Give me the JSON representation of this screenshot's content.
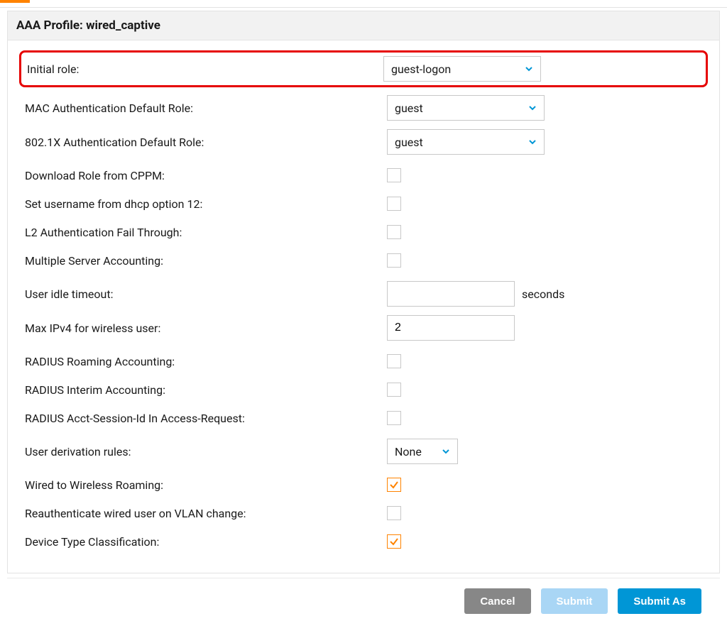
{
  "header": {
    "title": "AAA Profile: wired_captive"
  },
  "colors": {
    "accent_orange": "#ff8300",
    "accent_blue": "#0096d6",
    "highlight_red": "#e60000"
  },
  "fields": {
    "initial_role": {
      "label": "Initial role:",
      "value": "guest-logon"
    },
    "mac_auth_default_role": {
      "label": "MAC Authentication Default Role:",
      "value": "guest"
    },
    "dot1x_auth_default_role": {
      "label": "802.1X Authentication Default Role:",
      "value": "guest"
    },
    "download_role_cppm": {
      "label": "Download Role from CPPM:",
      "checked": false
    },
    "set_username_dhcp12": {
      "label": "Set username from dhcp option 12:",
      "checked": false
    },
    "l2_auth_fail_through": {
      "label": "L2 Authentication Fail Through:",
      "checked": false
    },
    "multiple_server_accounting": {
      "label": "Multiple Server Accounting:",
      "checked": false
    },
    "user_idle_timeout": {
      "label": "User idle timeout:",
      "value": "",
      "unit": "seconds"
    },
    "max_ipv4_wireless": {
      "label": "Max IPv4 for wireless user:",
      "value": "2"
    },
    "radius_roaming_accounting": {
      "label": "RADIUS Roaming Accounting:",
      "checked": false
    },
    "radius_interim_accounting": {
      "label": "RADIUS Interim Accounting:",
      "checked": false
    },
    "radius_acct_session_id": {
      "label": "RADIUS Acct-Session-Id In Access-Request:",
      "checked": false
    },
    "user_derivation_rules": {
      "label": "User derivation rules:",
      "value": "None"
    },
    "wired_wireless_roaming": {
      "label": "Wired to Wireless Roaming:",
      "checked": true
    },
    "reauth_wired_vlan": {
      "label": "Reauthenticate wired user on VLAN change:",
      "checked": false
    },
    "device_type_classification": {
      "label": "Device Type Classification:",
      "checked": true
    }
  },
  "footer": {
    "cancel": "Cancel",
    "submit": "Submit",
    "submit_as": "Submit As"
  }
}
